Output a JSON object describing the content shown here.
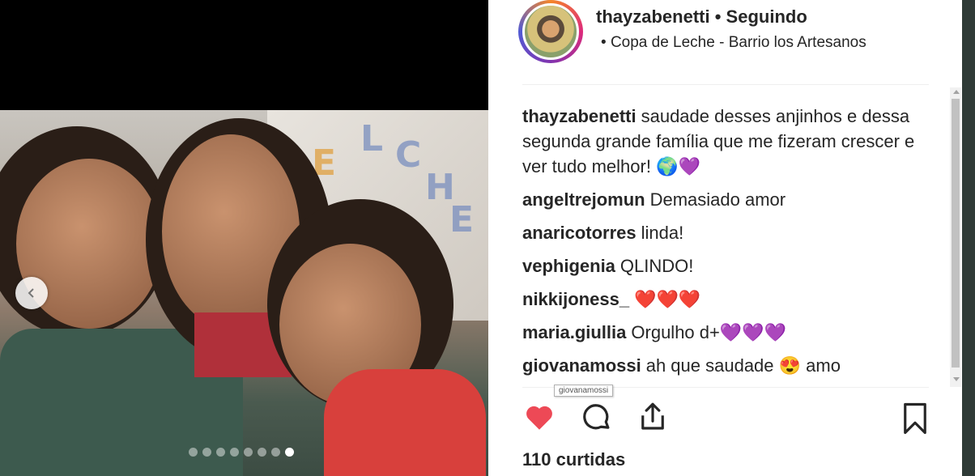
{
  "post": {
    "username": "thayzabenetti",
    "separator": "•",
    "follow_status": "Seguindo",
    "location": "Copa de Leche - Barrio los Artesanos",
    "location_bullet": "•"
  },
  "carousel": {
    "total_images": 8,
    "active_index": 7,
    "wall_letters": [
      "E",
      "C",
      "H",
      "E",
      "L",
      "E"
    ]
  },
  "comments": [
    {
      "user": "thayzabenetti",
      "text": "saudade desses anjinhos e dessa segunda grande família que me fizeram crescer e ver tudo melhor! 🌍💜"
    },
    {
      "user": "angeltrejomun",
      "text": "Demasiado amor"
    },
    {
      "user": "anaricotorres",
      "text": "linda!"
    },
    {
      "user": "vephigenia",
      "text": "QLINDO!"
    },
    {
      "user": "nikkijoness_",
      "text": "❤️❤️❤️"
    },
    {
      "user": "maria.giullia",
      "text": "Orgulho d+💜💜💜"
    },
    {
      "user": "giovanamossi",
      "text": "ah que saudade 😍 amo"
    }
  ],
  "tooltip": "giovanamossi",
  "likes": {
    "count_label": "110 curtidas"
  },
  "icons": {
    "like": "heart-filled-icon",
    "comment": "comment-bubble-icon",
    "share": "share-upload-icon",
    "save": "bookmark-icon",
    "prev": "chevron-left-icon"
  },
  "colors": {
    "like_red": "#ed4956",
    "text": "#262626",
    "divider": "#efefef"
  }
}
